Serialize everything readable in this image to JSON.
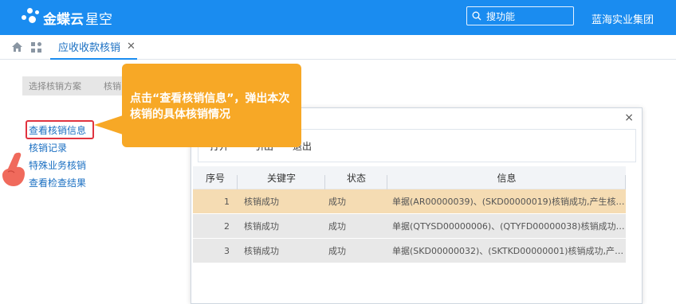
{
  "header": {
    "logo_main": "金蝶云",
    "logo_sub": "星空",
    "search_placeholder": "搜功能",
    "org_name": "蓝海实业集团",
    "brand_color": "#1a8cf0"
  },
  "tabbar": {
    "active_tab_label": "应收收款核销",
    "close_symbol": "✕"
  },
  "steps": [
    "选择核销方案",
    "核销"
  ],
  "links": [
    "查看核销信息",
    "核销记录",
    "特殊业务核销",
    "查看检查结果"
  ],
  "callout": {
    "text": "点击“查看核销信息”，弹出本次核销的具体核销情况",
    "color": "#f7a826"
  },
  "dialog": {
    "close_symbol": "×",
    "toolbar_buttons": [
      "打开",
      "引出",
      "退出"
    ],
    "columns": [
      "序号",
      "关键字",
      "状态",
      "信息"
    ],
    "rows": [
      {
        "no": "1",
        "key": "核销成功",
        "status": "成功",
        "info": "单据(AR00000039)、(SKD00000019)核销成功,产生核销..."
      },
      {
        "no": "2",
        "key": "核销成功",
        "status": "成功",
        "info": "单据(QTYSD00000006)、(QTYFD00000038)核销成功,产..."
      },
      {
        "no": "3",
        "key": "核销成功",
        "status": "成功",
        "info": "单据(SKD00000032)、(SKTKD00000001)核销成功,产生..."
      }
    ],
    "selected_row_color": "#f5dcb3",
    "row_color": "#e8e8e8"
  }
}
